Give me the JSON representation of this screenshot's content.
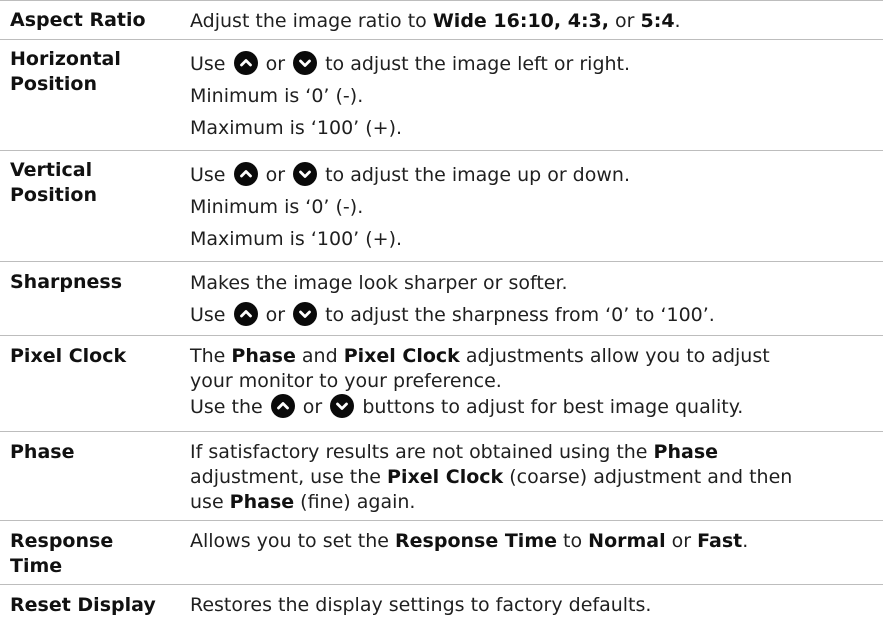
{
  "rows": [
    {
      "term": "Aspect Ratio",
      "lines": [
        [
          {
            "t": "Adjust the image ratio to "
          },
          {
            "t": "Wide 16:10, 4:3,",
            "b": true
          },
          {
            "t": " or "
          },
          {
            "t": "5:4",
            "b": true
          },
          {
            "t": "."
          }
        ]
      ]
    },
    {
      "term": "Horizontal Position",
      "lines": [
        [
          {
            "t": "Use "
          },
          {
            "icon": "up-arrow-icon"
          },
          {
            "t": " or "
          },
          {
            "icon": "down-arrow-icon"
          },
          {
            "t": " to adjust the image left or right."
          }
        ],
        [
          {
            "t": "Minimum is ‘0’ (-)."
          }
        ],
        [
          {
            "t": "Maximum is ‘100’ (+)."
          }
        ]
      ]
    },
    {
      "term": "Vertical Position",
      "lines": [
        [
          {
            "t": "Use "
          },
          {
            "icon": "up-arrow-icon"
          },
          {
            "t": " or "
          },
          {
            "icon": "down-arrow-icon"
          },
          {
            "t": " to adjust the image up or down."
          }
        ],
        [
          {
            "t": "Minimum is ‘0’ (-)."
          }
        ],
        [
          {
            "t": "Maximum is ‘100’ (+)."
          }
        ]
      ]
    },
    {
      "term": "Sharpness",
      "lines": [
        [
          {
            "t": "Makes the image look sharper or softer."
          }
        ],
        [
          {
            "t": "Use "
          },
          {
            "icon": "up-arrow-icon"
          },
          {
            "t": " or "
          },
          {
            "icon": "down-arrow-icon"
          },
          {
            "t": " to adjust the sharpness from ‘0’ to ‘100’."
          }
        ]
      ]
    },
    {
      "term": "Pixel Clock",
      "lines": [
        [
          {
            "t": "The "
          },
          {
            "t": "Phase",
            "b": true
          },
          {
            "t": " and "
          },
          {
            "t": "Pixel Clock",
            "b": true
          },
          {
            "t": " adjustments allow you to adjust"
          }
        ],
        [
          {
            "t": "your monitor to your preference."
          }
        ],
        [
          {
            "t": "Use the "
          },
          {
            "icon": "up-arrow-icon"
          },
          {
            "t": " or "
          },
          {
            "icon": "down-arrow-icon"
          },
          {
            "t": " buttons to adjust for best image quality."
          }
        ]
      ]
    },
    {
      "term": "Phase",
      "lines": [
        [
          {
            "t": "If satisfactory results are not obtained using the "
          },
          {
            "t": "Phase",
            "b": true
          }
        ],
        [
          {
            "t": "adjustment, use the "
          },
          {
            "t": "Pixel Clock",
            "b": true
          },
          {
            "t": " (coarse) adjustment and then"
          }
        ],
        [
          {
            "t": "use "
          },
          {
            "t": "Phase",
            "b": true
          },
          {
            "t": " (fine) again."
          }
        ]
      ]
    },
    {
      "term": "Response Time",
      "lines": [
        [
          {
            "t": "Allows you to set the "
          },
          {
            "t": "Response Time",
            "b": true
          },
          {
            "t": " to "
          },
          {
            "t": "Normal",
            "b": true
          },
          {
            "t": " or "
          },
          {
            "t": "Fast",
            "b": true
          },
          {
            "t": "."
          }
        ]
      ]
    },
    {
      "term": "Reset Display",
      "lines": [
        [
          {
            "t": "Restores the display settings to factory defaults."
          }
        ]
      ]
    }
  ],
  "colors": {
    "text": "#1f1f1f",
    "term": "#111111",
    "border": "#bdbdbd",
    "button": "#0a0a0a"
  }
}
